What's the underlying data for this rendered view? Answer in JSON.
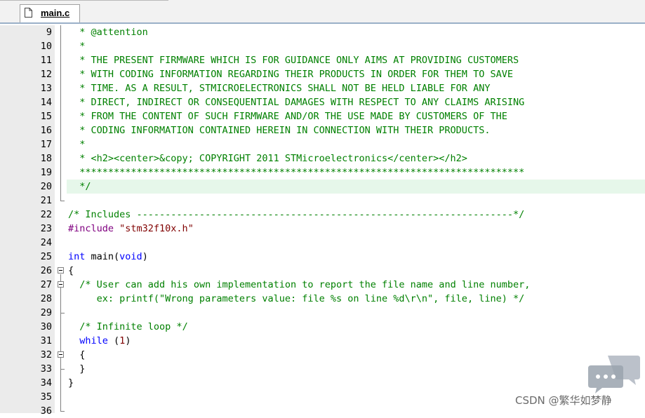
{
  "tab": {
    "file_name": "main.c",
    "icon": "file-icon"
  },
  "highlighted_line": 20,
  "lines": [
    {
      "num": "9",
      "segs": [
        [
          "comment",
          "  * @attention"
        ]
      ]
    },
    {
      "num": "10",
      "segs": [
        [
          "comment",
          "  *"
        ]
      ]
    },
    {
      "num": "11",
      "segs": [
        [
          "comment",
          "  * THE PRESENT FIRMWARE WHICH IS FOR GUIDANCE ONLY AIMS AT PROVIDING CUSTOMERS"
        ]
      ]
    },
    {
      "num": "12",
      "segs": [
        [
          "comment",
          "  * WITH CODING INFORMATION REGARDING THEIR PRODUCTS IN ORDER FOR THEM TO SAVE"
        ]
      ]
    },
    {
      "num": "13",
      "segs": [
        [
          "comment",
          "  * TIME. AS A RESULT, STMICROELECTRONICS SHALL NOT BE HELD LIABLE FOR ANY"
        ]
      ]
    },
    {
      "num": "14",
      "segs": [
        [
          "comment",
          "  * DIRECT, INDIRECT OR CONSEQUENTIAL DAMAGES WITH RESPECT TO ANY CLAIMS ARISING"
        ]
      ]
    },
    {
      "num": "15",
      "segs": [
        [
          "comment",
          "  * FROM THE CONTENT OF SUCH FIRMWARE AND/OR THE USE MADE BY CUSTOMERS OF THE"
        ]
      ]
    },
    {
      "num": "16",
      "segs": [
        [
          "comment",
          "  * CODING INFORMATION CONTAINED HEREIN IN CONNECTION WITH THEIR PRODUCTS."
        ]
      ]
    },
    {
      "num": "17",
      "segs": [
        [
          "comment",
          "  *"
        ]
      ]
    },
    {
      "num": "18",
      "segs": [
        [
          "comment",
          "  * <h2><center>&copy; COPYRIGHT 2011 STMicroelectronics</center></h2>"
        ]
      ]
    },
    {
      "num": "19",
      "segs": [
        [
          "comment",
          "  ******************************************************************************"
        ]
      ]
    },
    {
      "num": "20",
      "segs": [
        [
          "comment",
          "  */"
        ]
      ]
    },
    {
      "num": "21",
      "segs": []
    },
    {
      "num": "22",
      "segs": [
        [
          "comment",
          "/* Includes ------------------------------------------------------------------*/"
        ]
      ]
    },
    {
      "num": "23",
      "segs": [
        [
          "pp",
          "#include "
        ],
        [
          "str",
          "\"stm32f10x.h\""
        ]
      ]
    },
    {
      "num": "24",
      "segs": []
    },
    {
      "num": "25",
      "segs": [
        [
          "kw",
          "int"
        ],
        [
          "plain",
          " main("
        ],
        [
          "kw",
          "void"
        ],
        [
          "plain",
          ")"
        ]
      ]
    },
    {
      "num": "26",
      "segs": [
        [
          "plain",
          "{"
        ]
      ]
    },
    {
      "num": "27",
      "segs": [
        [
          "plain",
          "  "
        ],
        [
          "comment",
          "/* User can add his own implementation to report the file name and line number,"
        ]
      ]
    },
    {
      "num": "28",
      "segs": [
        [
          "comment",
          "     ex: printf(\"Wrong parameters value: file %s on line %d\\r\\n\", file, line) */"
        ]
      ]
    },
    {
      "num": "29",
      "segs": []
    },
    {
      "num": "30",
      "segs": [
        [
          "plain",
          "  "
        ],
        [
          "comment",
          "/* Infinite loop */"
        ]
      ]
    },
    {
      "num": "31",
      "segs": [
        [
          "plain",
          "  "
        ],
        [
          "kw",
          "while"
        ],
        [
          "plain",
          " ("
        ],
        [
          "num",
          "1"
        ],
        [
          "plain",
          ")"
        ]
      ]
    },
    {
      "num": "32",
      "segs": [
        [
          "plain",
          "  {"
        ]
      ]
    },
    {
      "num": "33",
      "segs": [
        [
          "plain",
          "  }"
        ]
      ]
    },
    {
      "num": "34",
      "segs": [
        [
          "plain",
          "}"
        ]
      ]
    },
    {
      "num": "35",
      "segs": []
    },
    {
      "num": "36",
      "segs": []
    }
  ],
  "watermark": {
    "text": "CSDN @繁华如梦静",
    "icon": "chat-bubbles-icon"
  },
  "colors": {
    "comment": "#008000",
    "keyword": "#0000ff",
    "preprocessor": "#800080",
    "string": "#800000",
    "highlight": "#e6f7ea",
    "gutter": "#ebebeb"
  }
}
